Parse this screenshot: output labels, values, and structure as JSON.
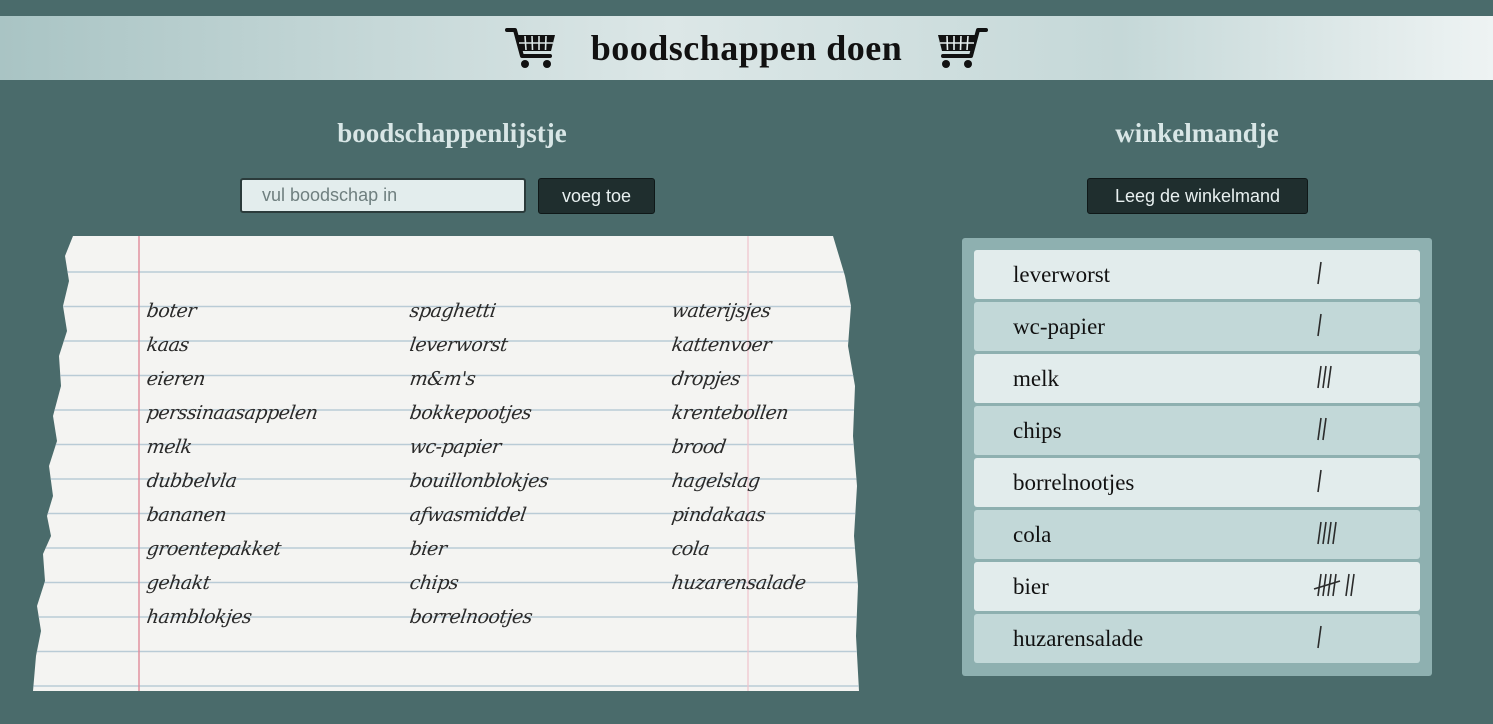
{
  "header": {
    "title": "boodschappen doen",
    "left_icon": "cart-icon",
    "right_icon": "cart-icon"
  },
  "shopping_list": {
    "title": "boodschappenlijstje",
    "input_placeholder": "vul boodschap in",
    "add_button": "voeg toe",
    "columns": [
      [
        "boter",
        "kaas",
        "eieren",
        "perssinaasappelen",
        "melk",
        "dubbelvla",
        "bananen",
        "groentepakket",
        "gehakt",
        "hamblokjes"
      ],
      [
        "spaghetti",
        "leverworst",
        "m&m's",
        "bokkepootjes",
        "wc-papier",
        "bouillonblokjes",
        "afwasmiddel",
        "bier",
        "chips",
        "borrelnootjes"
      ],
      [
        "waterijsjes",
        "kattenvoer",
        "dropjes",
        "krentebollen",
        "brood",
        "hagelslag",
        "pindakaas",
        "cola",
        "huzarensalade"
      ]
    ]
  },
  "basket": {
    "title": "winkelmandje",
    "empty_button": "Leeg de winkelmand",
    "items": [
      {
        "name": "leverworst",
        "count": 1
      },
      {
        "name": "wc-papier",
        "count": 1
      },
      {
        "name": "melk",
        "count": 3
      },
      {
        "name": "chips",
        "count": 2
      },
      {
        "name": "borrelnootjes",
        "count": 1
      },
      {
        "name": "cola",
        "count": 4
      },
      {
        "name": "bier",
        "count": 7
      },
      {
        "name": "huzarensalade",
        "count": 1
      }
    ]
  },
  "colors": {
    "background": "#4a6b6b",
    "button": "#1f2e2e",
    "basket_panel": "#8eb0b0",
    "row_light": "#e2ecec",
    "row_dark": "#c2d8d8"
  }
}
